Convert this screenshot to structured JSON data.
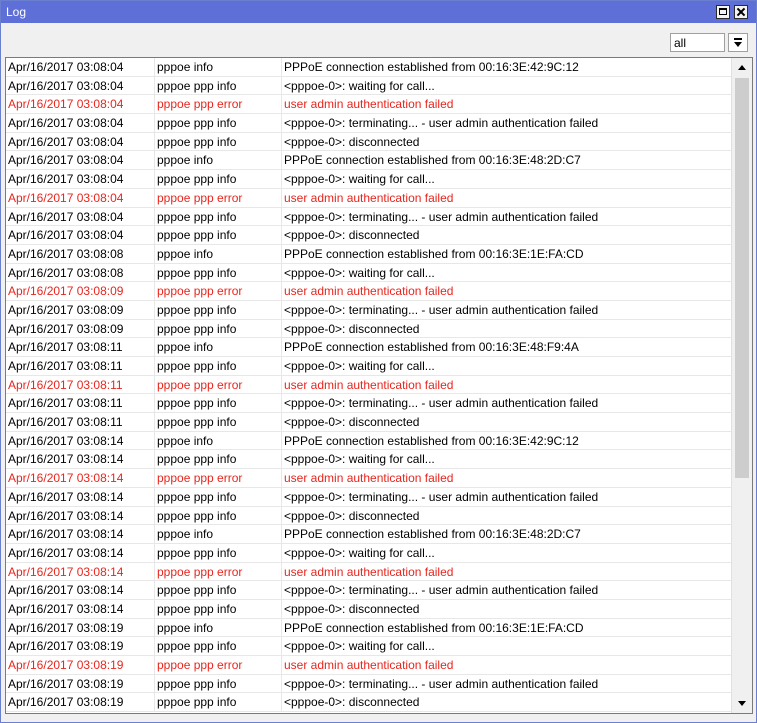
{
  "window": {
    "title": "Log"
  },
  "filter": {
    "value": "all"
  },
  "log": {
    "rows": [
      {
        "time": "Apr/16/2017 03:08:04",
        "topic": "pppoe info",
        "message": "PPPoE connection established from 00:16:3E:42:9C:12",
        "level": "info"
      },
      {
        "time": "Apr/16/2017 03:08:04",
        "topic": "pppoe ppp info",
        "message": "<pppoe-0>: waiting for call...",
        "level": "info"
      },
      {
        "time": "Apr/16/2017 03:08:04",
        "topic": "pppoe ppp error",
        "message": "user admin authentication failed",
        "level": "error"
      },
      {
        "time": "Apr/16/2017 03:08:04",
        "topic": "pppoe ppp info",
        "message": "<pppoe-0>: terminating... - user admin authentication failed",
        "level": "info"
      },
      {
        "time": "Apr/16/2017 03:08:04",
        "topic": "pppoe ppp info",
        "message": "<pppoe-0>: disconnected",
        "level": "info"
      },
      {
        "time": "Apr/16/2017 03:08:04",
        "topic": "pppoe info",
        "message": "PPPoE connection established from 00:16:3E:48:2D:C7",
        "level": "info"
      },
      {
        "time": "Apr/16/2017 03:08:04",
        "topic": "pppoe ppp info",
        "message": "<pppoe-0>: waiting for call...",
        "level": "info"
      },
      {
        "time": "Apr/16/2017 03:08:04",
        "topic": "pppoe ppp error",
        "message": "user admin authentication failed",
        "level": "error"
      },
      {
        "time": "Apr/16/2017 03:08:04",
        "topic": "pppoe ppp info",
        "message": "<pppoe-0>: terminating... - user admin authentication failed",
        "level": "info"
      },
      {
        "time": "Apr/16/2017 03:08:04",
        "topic": "pppoe ppp info",
        "message": "<pppoe-0>: disconnected",
        "level": "info"
      },
      {
        "time": "Apr/16/2017 03:08:08",
        "topic": "pppoe info",
        "message": "PPPoE connection established from 00:16:3E:1E:FA:CD",
        "level": "info"
      },
      {
        "time": "Apr/16/2017 03:08:08",
        "topic": "pppoe ppp info",
        "message": "<pppoe-0>: waiting for call...",
        "level": "info"
      },
      {
        "time": "Apr/16/2017 03:08:09",
        "topic": "pppoe ppp error",
        "message": "user admin authentication failed",
        "level": "error"
      },
      {
        "time": "Apr/16/2017 03:08:09",
        "topic": "pppoe ppp info",
        "message": "<pppoe-0>: terminating... - user admin authentication failed",
        "level": "info"
      },
      {
        "time": "Apr/16/2017 03:08:09",
        "topic": "pppoe ppp info",
        "message": "<pppoe-0>: disconnected",
        "level": "info"
      },
      {
        "time": "Apr/16/2017 03:08:11",
        "topic": "pppoe info",
        "message": "PPPoE connection established from 00:16:3E:48:F9:4A",
        "level": "info"
      },
      {
        "time": "Apr/16/2017 03:08:11",
        "topic": "pppoe ppp info",
        "message": "<pppoe-0>: waiting for call...",
        "level": "info"
      },
      {
        "time": "Apr/16/2017 03:08:11",
        "topic": "pppoe ppp error",
        "message": "user admin authentication failed",
        "level": "error"
      },
      {
        "time": "Apr/16/2017 03:08:11",
        "topic": "pppoe ppp info",
        "message": "<pppoe-0>: terminating... - user admin authentication failed",
        "level": "info"
      },
      {
        "time": "Apr/16/2017 03:08:11",
        "topic": "pppoe ppp info",
        "message": "<pppoe-0>: disconnected",
        "level": "info"
      },
      {
        "time": "Apr/16/2017 03:08:14",
        "topic": "pppoe info",
        "message": "PPPoE connection established from 00:16:3E:42:9C:12",
        "level": "info"
      },
      {
        "time": "Apr/16/2017 03:08:14",
        "topic": "pppoe ppp info",
        "message": "<pppoe-0>: waiting for call...",
        "level": "info"
      },
      {
        "time": "Apr/16/2017 03:08:14",
        "topic": "pppoe ppp error",
        "message": "user admin authentication failed",
        "level": "error"
      },
      {
        "time": "Apr/16/2017 03:08:14",
        "topic": "pppoe ppp info",
        "message": "<pppoe-0>: terminating... - user admin authentication failed",
        "level": "info"
      },
      {
        "time": "Apr/16/2017 03:08:14",
        "topic": "pppoe ppp info",
        "message": "<pppoe-0>: disconnected",
        "level": "info"
      },
      {
        "time": "Apr/16/2017 03:08:14",
        "topic": "pppoe info",
        "message": "PPPoE connection established from 00:16:3E:48:2D:C7",
        "level": "info"
      },
      {
        "time": "Apr/16/2017 03:08:14",
        "topic": "pppoe ppp info",
        "message": "<pppoe-0>: waiting for call...",
        "level": "info"
      },
      {
        "time": "Apr/16/2017 03:08:14",
        "topic": "pppoe ppp error",
        "message": "user admin authentication failed",
        "level": "error"
      },
      {
        "time": "Apr/16/2017 03:08:14",
        "topic": "pppoe ppp info",
        "message": "<pppoe-0>: terminating... - user admin authentication failed",
        "level": "info"
      },
      {
        "time": "Apr/16/2017 03:08:14",
        "topic": "pppoe ppp info",
        "message": "<pppoe-0>: disconnected",
        "level": "info"
      },
      {
        "time": "Apr/16/2017 03:08:19",
        "topic": "pppoe info",
        "message": "PPPoE connection established from 00:16:3E:1E:FA:CD",
        "level": "info"
      },
      {
        "time": "Apr/16/2017 03:08:19",
        "topic": "pppoe ppp info",
        "message": "<pppoe-0>: waiting for call...",
        "level": "info"
      },
      {
        "time": "Apr/16/2017 03:08:19",
        "topic": "pppoe ppp error",
        "message": "user admin authentication failed",
        "level": "error"
      },
      {
        "time": "Apr/16/2017 03:08:19",
        "topic": "pppoe ppp info",
        "message": "<pppoe-0>: terminating... - user admin authentication failed",
        "level": "info"
      },
      {
        "time": "Apr/16/2017 03:08:19",
        "topic": "pppoe ppp info",
        "message": "<pppoe-0>: disconnected",
        "level": "info"
      }
    ]
  },
  "colors": {
    "titlebar": "#5f6fd8",
    "error_text": "#e8261e"
  },
  "icons": {
    "maximize": "maximize-icon",
    "close": "close-icon",
    "dropdown": "dropdown-arrow-icon",
    "scroll_up": "scroll-up-icon",
    "scroll_down": "scroll-down-icon"
  }
}
